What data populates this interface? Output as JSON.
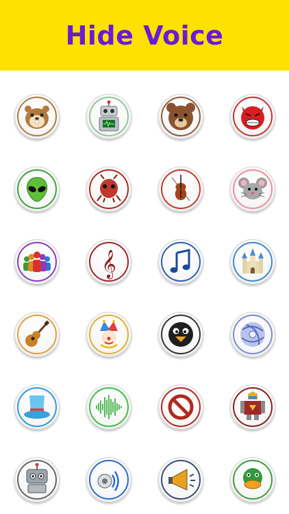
{
  "app": {
    "title": "Hide Voice"
  },
  "colors": {
    "header_bg": "#ffe100",
    "title": "#6a1bd8"
  },
  "voices": [
    {
      "name": "hamster-icon",
      "ring": "#b07a3c"
    },
    {
      "name": "robot-icon",
      "ring": "#8fc79a"
    },
    {
      "name": "bear-icon",
      "ring": "#8a5a3a"
    },
    {
      "name": "devil-icon",
      "ring": "#c8302c"
    },
    {
      "name": "alien-icon",
      "ring": "#3aa33c"
    },
    {
      "name": "ant-icon",
      "ring": "#b02a1e"
    },
    {
      "name": "violin-icon",
      "ring": "#c0392b"
    },
    {
      "name": "mouse-icon",
      "ring": "#f08aa0"
    },
    {
      "name": "crowd-icon",
      "ring": "#8a3bc0"
    },
    {
      "name": "treble-clef-icon",
      "ring": "#a0242c"
    },
    {
      "name": "music-note-icon",
      "ring": "#2a5fb0"
    },
    {
      "name": "castle-icon",
      "ring": "#3a8ad0"
    },
    {
      "name": "guitar-icon",
      "ring": "#e0a03c"
    },
    {
      "name": "jester-icon",
      "ring": "#e0b030"
    },
    {
      "name": "penguin-icon",
      "ring": "#333333"
    },
    {
      "name": "disc-icon",
      "ring": "#7a8ad0"
    },
    {
      "name": "top-hat-icon",
      "ring": "#2a9ad8"
    },
    {
      "name": "sound-wave-icon",
      "ring": "#3ac040"
    },
    {
      "name": "prohibited-icon",
      "ring": "#b02a1e"
    },
    {
      "name": "mech-robot-icon",
      "ring": "#8a2020"
    },
    {
      "name": "robot-box-icon",
      "ring": "#666666"
    },
    {
      "name": "speaker-icon",
      "ring": "#2a6ad0"
    },
    {
      "name": "megaphone-icon",
      "ring": "#3a4a70"
    },
    {
      "name": "duck-icon",
      "ring": "#3aa03a"
    }
  ]
}
